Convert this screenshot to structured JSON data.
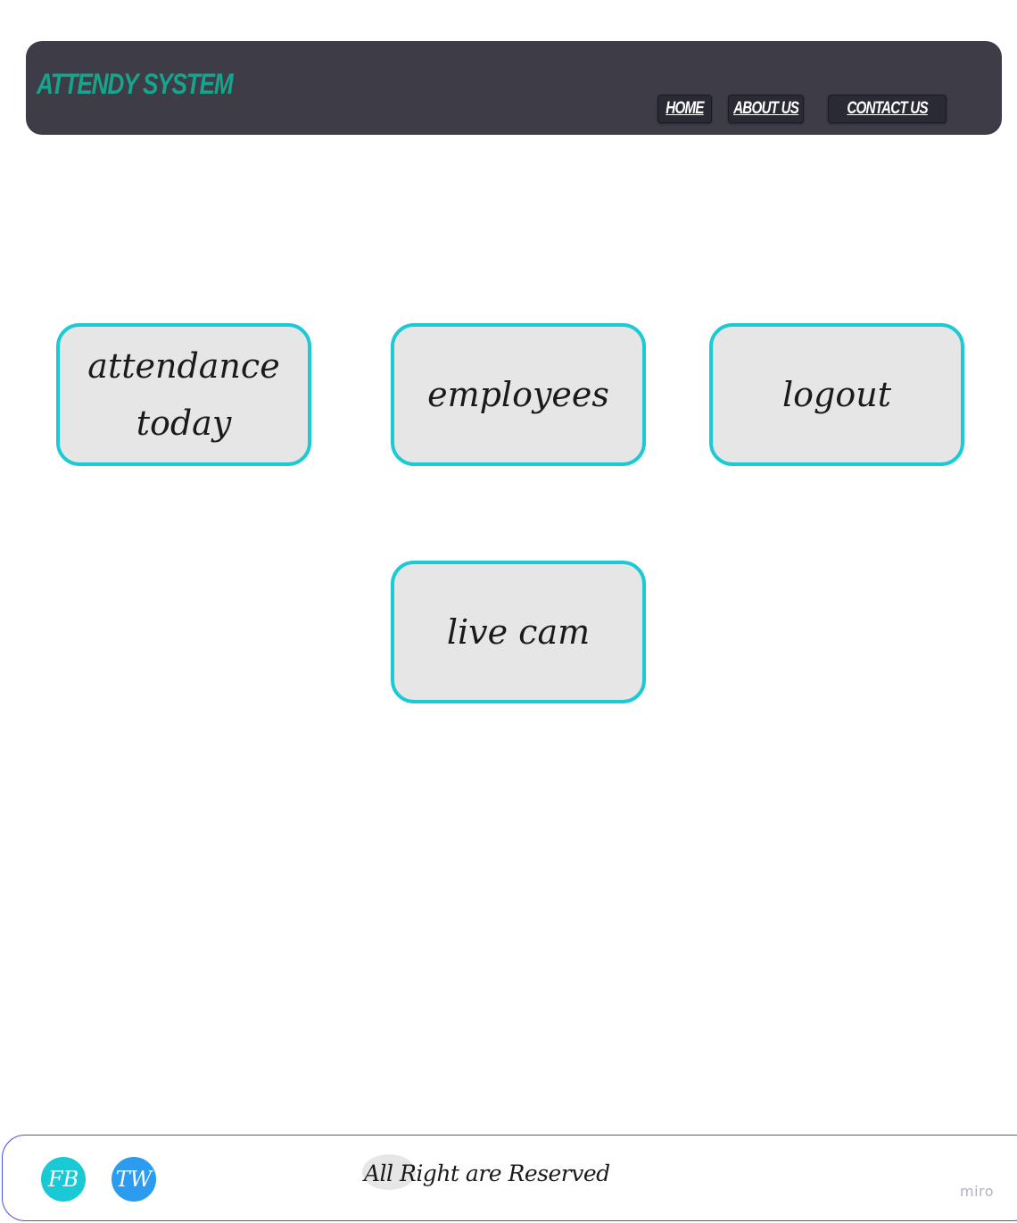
{
  "header": {
    "brand": "ATTENDY SYSTEM",
    "nav": [
      {
        "label": "HOME"
      },
      {
        "label": "ABOUT US"
      },
      {
        "label": "CONTACT US"
      }
    ]
  },
  "cards": [
    {
      "label": "attendance today"
    },
    {
      "label": "employees"
    },
    {
      "label": "logout"
    },
    {
      "label": "live cam"
    }
  ],
  "footer": {
    "social": [
      {
        "label": "FB",
        "color": "#19c9d5"
      },
      {
        "label": "TW",
        "color": "#2c9cf0"
      }
    ],
    "copyright": "All Right are Reserved"
  },
  "watermark": "miro",
  "colors": {
    "header_bg": "#3d3c47",
    "brand": "#16a58c",
    "card_border": "#1ccad6",
    "card_bg": "#e6e6e6",
    "footer_border": "#4a4ee0"
  }
}
